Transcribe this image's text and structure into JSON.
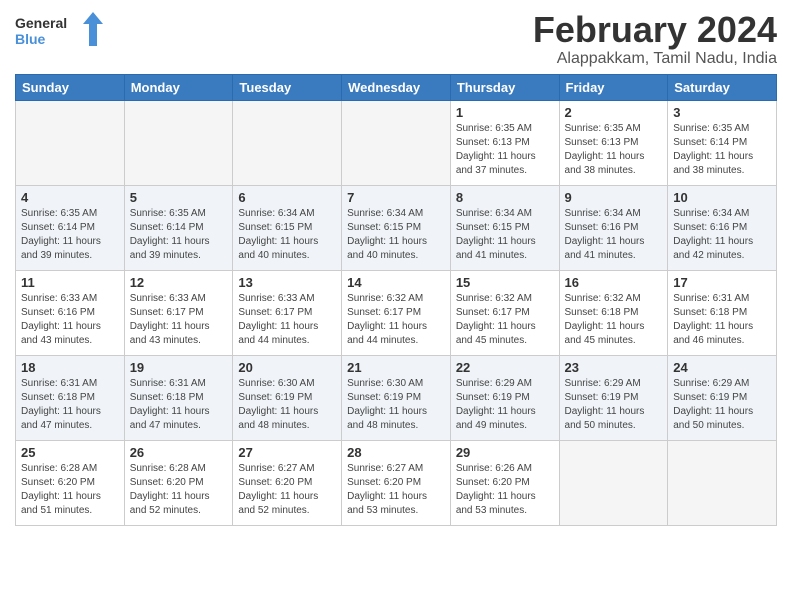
{
  "header": {
    "logo_general": "General",
    "logo_blue": "Blue",
    "title": "February 2024",
    "subtitle": "Alappakkam, Tamil Nadu, India"
  },
  "days_of_week": [
    "Sunday",
    "Monday",
    "Tuesday",
    "Wednesday",
    "Thursday",
    "Friday",
    "Saturday"
  ],
  "weeks": [
    [
      {
        "day": "",
        "info": ""
      },
      {
        "day": "",
        "info": ""
      },
      {
        "day": "",
        "info": ""
      },
      {
        "day": "",
        "info": ""
      },
      {
        "day": "1",
        "info": "Sunrise: 6:35 AM\nSunset: 6:13 PM\nDaylight: 11 hours and 37 minutes."
      },
      {
        "day": "2",
        "info": "Sunrise: 6:35 AM\nSunset: 6:13 PM\nDaylight: 11 hours and 38 minutes."
      },
      {
        "day": "3",
        "info": "Sunrise: 6:35 AM\nSunset: 6:14 PM\nDaylight: 11 hours and 38 minutes."
      }
    ],
    [
      {
        "day": "4",
        "info": "Sunrise: 6:35 AM\nSunset: 6:14 PM\nDaylight: 11 hours and 39 minutes."
      },
      {
        "day": "5",
        "info": "Sunrise: 6:35 AM\nSunset: 6:14 PM\nDaylight: 11 hours and 39 minutes."
      },
      {
        "day": "6",
        "info": "Sunrise: 6:34 AM\nSunset: 6:15 PM\nDaylight: 11 hours and 40 minutes."
      },
      {
        "day": "7",
        "info": "Sunrise: 6:34 AM\nSunset: 6:15 PM\nDaylight: 11 hours and 40 minutes."
      },
      {
        "day": "8",
        "info": "Sunrise: 6:34 AM\nSunset: 6:15 PM\nDaylight: 11 hours and 41 minutes."
      },
      {
        "day": "9",
        "info": "Sunrise: 6:34 AM\nSunset: 6:16 PM\nDaylight: 11 hours and 41 minutes."
      },
      {
        "day": "10",
        "info": "Sunrise: 6:34 AM\nSunset: 6:16 PM\nDaylight: 11 hours and 42 minutes."
      }
    ],
    [
      {
        "day": "11",
        "info": "Sunrise: 6:33 AM\nSunset: 6:16 PM\nDaylight: 11 hours and 43 minutes."
      },
      {
        "day": "12",
        "info": "Sunrise: 6:33 AM\nSunset: 6:17 PM\nDaylight: 11 hours and 43 minutes."
      },
      {
        "day": "13",
        "info": "Sunrise: 6:33 AM\nSunset: 6:17 PM\nDaylight: 11 hours and 44 minutes."
      },
      {
        "day": "14",
        "info": "Sunrise: 6:32 AM\nSunset: 6:17 PM\nDaylight: 11 hours and 44 minutes."
      },
      {
        "day": "15",
        "info": "Sunrise: 6:32 AM\nSunset: 6:17 PM\nDaylight: 11 hours and 45 minutes."
      },
      {
        "day": "16",
        "info": "Sunrise: 6:32 AM\nSunset: 6:18 PM\nDaylight: 11 hours and 45 minutes."
      },
      {
        "day": "17",
        "info": "Sunrise: 6:31 AM\nSunset: 6:18 PM\nDaylight: 11 hours and 46 minutes."
      }
    ],
    [
      {
        "day": "18",
        "info": "Sunrise: 6:31 AM\nSunset: 6:18 PM\nDaylight: 11 hours and 47 minutes."
      },
      {
        "day": "19",
        "info": "Sunrise: 6:31 AM\nSunset: 6:18 PM\nDaylight: 11 hours and 47 minutes."
      },
      {
        "day": "20",
        "info": "Sunrise: 6:30 AM\nSunset: 6:19 PM\nDaylight: 11 hours and 48 minutes."
      },
      {
        "day": "21",
        "info": "Sunrise: 6:30 AM\nSunset: 6:19 PM\nDaylight: 11 hours and 48 minutes."
      },
      {
        "day": "22",
        "info": "Sunrise: 6:29 AM\nSunset: 6:19 PM\nDaylight: 11 hours and 49 minutes."
      },
      {
        "day": "23",
        "info": "Sunrise: 6:29 AM\nSunset: 6:19 PM\nDaylight: 11 hours and 50 minutes."
      },
      {
        "day": "24",
        "info": "Sunrise: 6:29 AM\nSunset: 6:19 PM\nDaylight: 11 hours and 50 minutes."
      }
    ],
    [
      {
        "day": "25",
        "info": "Sunrise: 6:28 AM\nSunset: 6:20 PM\nDaylight: 11 hours and 51 minutes."
      },
      {
        "day": "26",
        "info": "Sunrise: 6:28 AM\nSunset: 6:20 PM\nDaylight: 11 hours and 52 minutes."
      },
      {
        "day": "27",
        "info": "Sunrise: 6:27 AM\nSunset: 6:20 PM\nDaylight: 11 hours and 52 minutes."
      },
      {
        "day": "28",
        "info": "Sunrise: 6:27 AM\nSunset: 6:20 PM\nDaylight: 11 hours and 53 minutes."
      },
      {
        "day": "29",
        "info": "Sunrise: 6:26 AM\nSunset: 6:20 PM\nDaylight: 11 hours and 53 minutes."
      },
      {
        "day": "",
        "info": ""
      },
      {
        "day": "",
        "info": ""
      }
    ]
  ]
}
